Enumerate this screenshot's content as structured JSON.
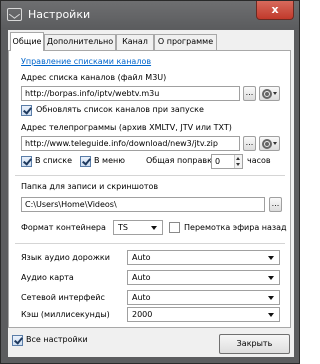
{
  "window": {
    "title": "Настройки",
    "close_glyph": "x",
    "title_bar_color": "#5c5d5f",
    "close_button_color": "#c84234"
  },
  "tabs": [
    "Общие",
    "Дополнительно",
    "Канал",
    "О программе"
  ],
  "general": {
    "manage_channel_lists_link": "Управление списками каналов",
    "channel_list_address_label": "Адрес списка каналов (файл M3U)",
    "channel_list_address_value": "http://borpas.info/iptv/webtv.m3u",
    "update_on_start_label": "Обновлять список каналов при запуске",
    "update_on_start_checked": true,
    "tv_guide_address_label": "Адрес телепрограммы (архив XMLTV, JTV или TXT)",
    "tv_guide_address_value": "http://www.teleguide.info/download/new3/jtv.zip",
    "in_list_label": "В списке",
    "in_list_checked": true,
    "in_menu_label": "В меню",
    "in_menu_checked": true,
    "time_offset_label": "Общая поправка",
    "time_offset_value": "0",
    "time_offset_unit": "часов",
    "record_folder_label": "Папка для записи и скриншотов",
    "record_folder_value": "C:\\Users\\Home\\Videos\\",
    "container_format_label": "Формат контейнера",
    "container_format_value": "TS",
    "timeshift_label": "Перемотка эфира назад",
    "timeshift_checked": false,
    "audio_language_label": "Язык аудио дорожки",
    "audio_language_value": "Auto",
    "audio_card_label": "Аудио карта",
    "audio_card_value": "Auto",
    "network_interface_label": "Сетевой интерфейс",
    "network_interface_value": "Auto",
    "cache_label": "Кэш (миллисекунды)",
    "cache_value": "2000",
    "browse_glyph": "..."
  },
  "footer": {
    "all_settings_label": "Все настройки",
    "all_settings_checked": true,
    "close_button_label": "Закрыть"
  },
  "icons": [
    "app-icon",
    "gear-icon",
    "dropdown-caret-icon",
    "checkmark-icon"
  ]
}
